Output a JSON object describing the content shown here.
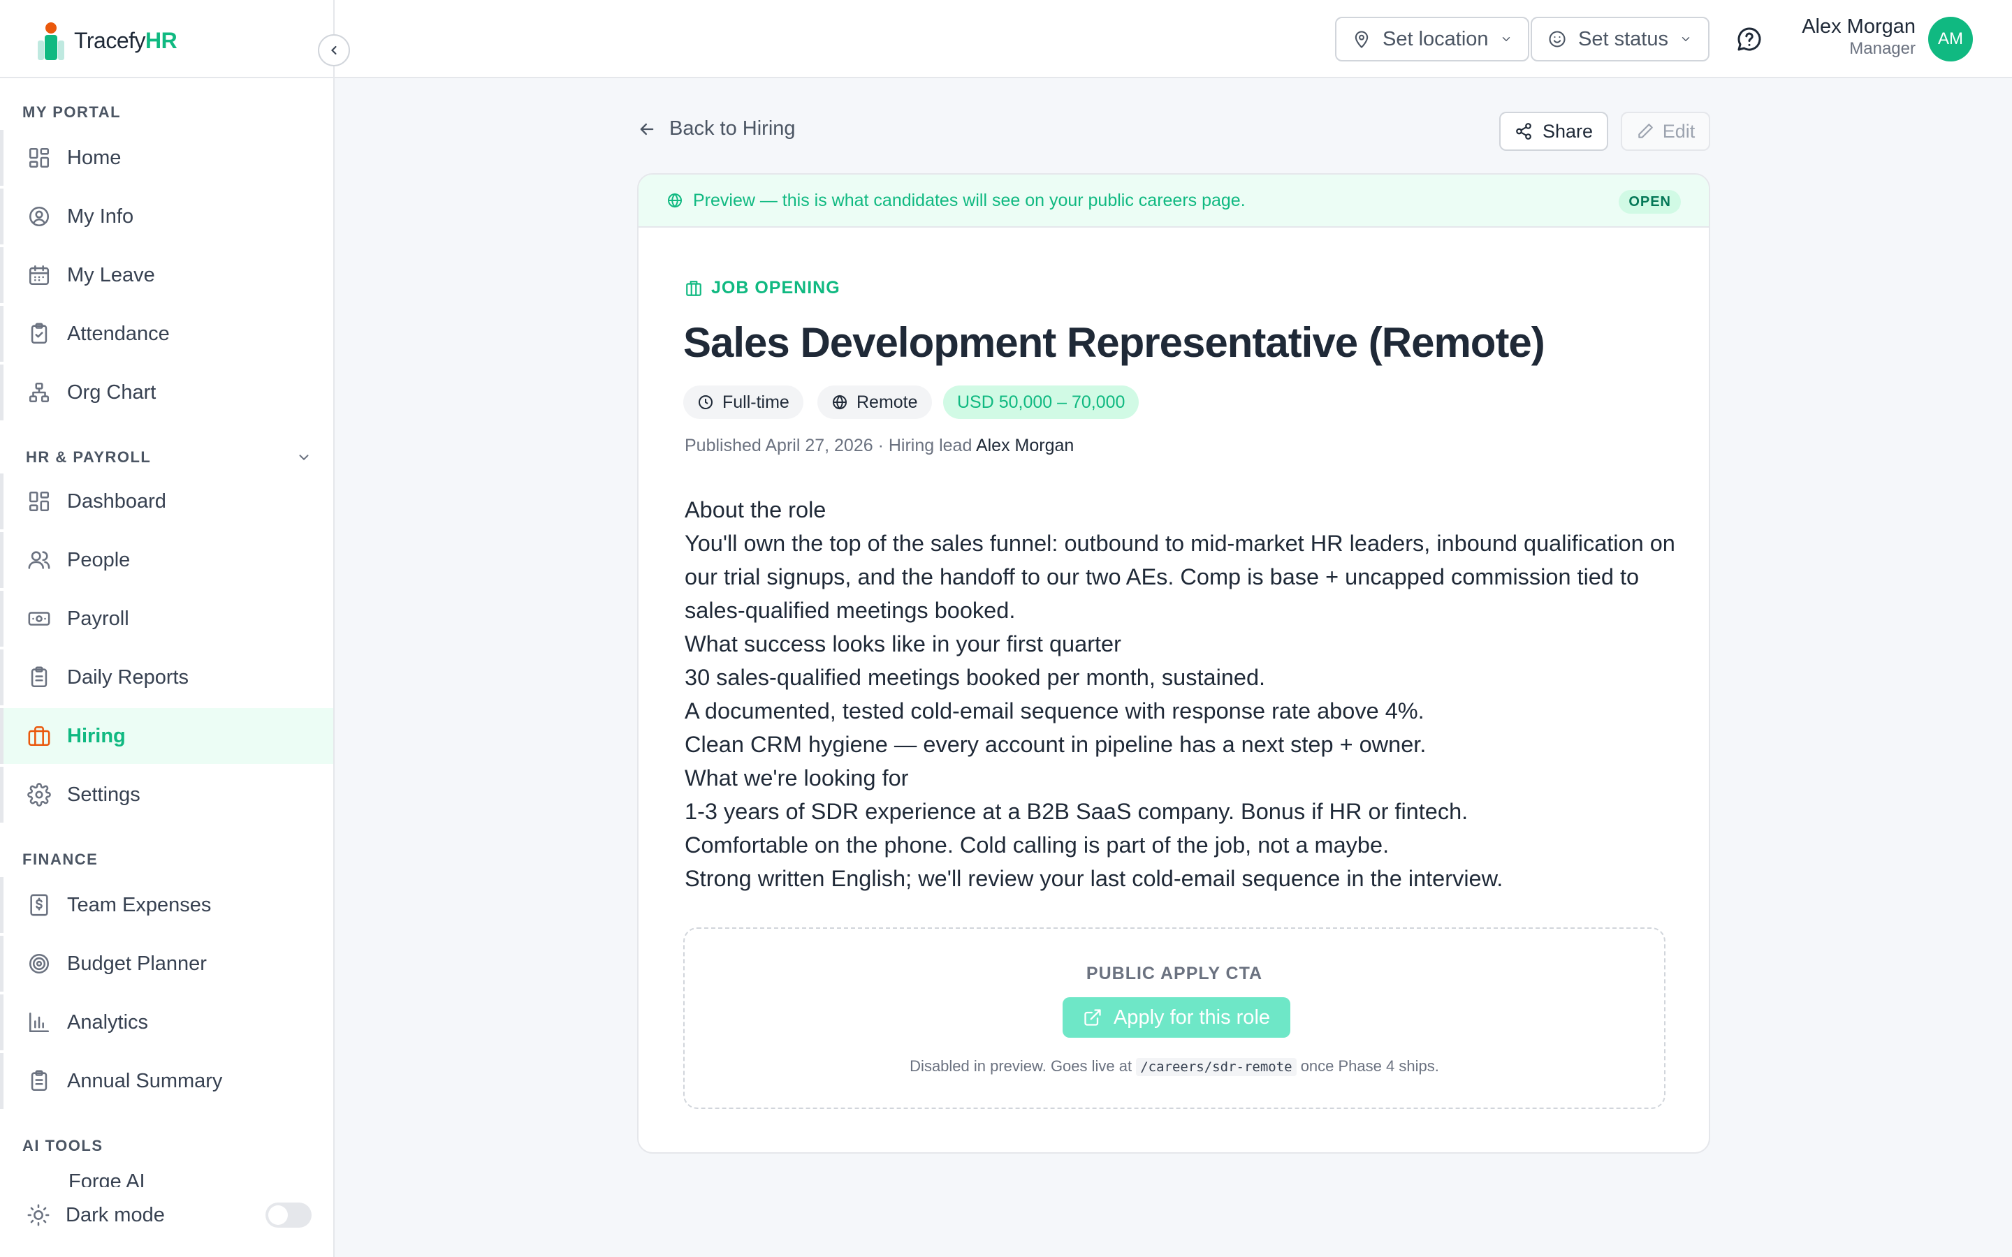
{
  "app": {
    "logo_text_plain": "Tracefy",
    "logo_text_accent": "HR",
    "accent_color": "#10b981"
  },
  "sidebar": {
    "sections": [
      {
        "label": "MY PORTAL"
      },
      {
        "label": "HR & PAYROLL"
      },
      {
        "label": "FINANCE"
      },
      {
        "label": "AI TOOLS"
      }
    ],
    "my_portal": [
      {
        "label": "Home",
        "icon": "grid-icon"
      },
      {
        "label": "My Info",
        "icon": "user-circle-icon"
      },
      {
        "label": "My Leave",
        "icon": "calendar-icon"
      },
      {
        "label": "Attendance",
        "icon": "clipboard-check-icon"
      },
      {
        "label": "Org Chart",
        "icon": "org-chart-icon"
      }
    ],
    "hr_payroll": [
      {
        "label": "Dashboard",
        "icon": "grid-icon"
      },
      {
        "label": "People",
        "icon": "users-icon"
      },
      {
        "label": "Payroll",
        "icon": "banknote-icon"
      },
      {
        "label": "Daily Reports",
        "icon": "clipboard-list-icon"
      },
      {
        "label": "Hiring",
        "icon": "briefcase-icon",
        "active": true
      },
      {
        "label": "Settings",
        "icon": "gear-icon"
      }
    ],
    "finance": [
      {
        "label": "Team Expenses",
        "icon": "receipt-dollar-icon"
      },
      {
        "label": "Budget Planner",
        "icon": "target-icon"
      },
      {
        "label": "Analytics",
        "icon": "bar-chart-icon"
      },
      {
        "label": "Annual Summary",
        "icon": "clipboard-list-icon"
      }
    ],
    "ai_tools_partial": "Forge AI",
    "dark_mode_label": "Dark mode"
  },
  "topbar": {
    "location_label": "Set location",
    "status_label": "Set status",
    "user_name": "Alex Morgan",
    "user_role": "Manager",
    "avatar_initials": "AM"
  },
  "page": {
    "back_label": "Back to Hiring",
    "share_label": "Share",
    "edit_label": "Edit",
    "preview_text": "Preview — this is what candidates will see on your public careers page.",
    "status_badge": "OPEN",
    "job_label": "JOB OPENING",
    "job_title": "Sales Development Representative (Remote)",
    "chips": {
      "type": "Full-time",
      "location": "Remote",
      "salary": "USD 50,000 – 70,000"
    },
    "meta_prefix": "Published April 27, 2026 · Hiring lead ",
    "meta_lead": "Alex Morgan",
    "description": [
      "About the role",
      "You'll own the top of the sales funnel: outbound to mid-market HR leaders, inbound qualification on our trial signups, and the handoff to our two AEs. Comp is base + uncapped commission tied to sales-qualified meetings booked.",
      "What success looks like in your first quarter",
      "30 sales-qualified meetings booked per month, sustained.",
      "A documented, tested cold-email sequence with response rate above 4%.",
      "Clean CRM hygiene — every account in pipeline has a next step + owner.",
      "What we're looking for",
      "1-3 years of SDR experience at a B2B SaaS company. Bonus if HR or fintech.",
      "Comfortable on the phone. Cold calling is part of the job, not a maybe.",
      "Strong written English; we'll review your last cold-email sequence in the interview."
    ],
    "cta": {
      "label": "PUBLIC APPLY CTA",
      "button": "Apply for this role",
      "note_before": "Disabled in preview. Goes live at ",
      "note_path": "/careers/sdr-remote",
      "note_after": " once Phase 4 ships."
    }
  }
}
